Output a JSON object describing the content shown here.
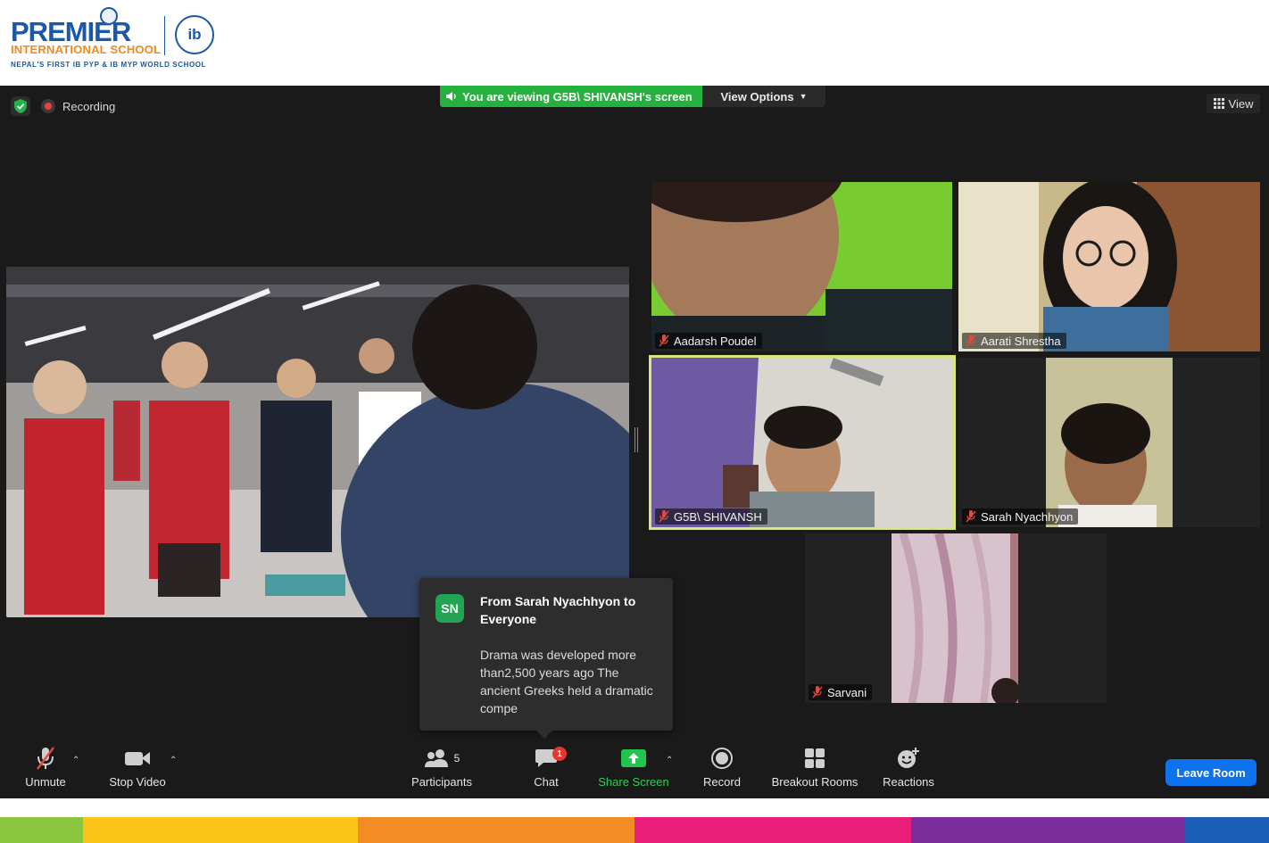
{
  "logo": {
    "name": "PREMIER",
    "subtitle": "INTERNATIONAL SCHOOL",
    "tagline": "NEPAL'S FIRST IB PYP & IB MYP WORLD SCHOOL",
    "ib_text": "ib"
  },
  "meeting": {
    "recording_label": "Recording",
    "viewing_banner": "You are viewing G5B\\ SHIVANSH's screen",
    "view_options_label": "View Options",
    "view_label": "View"
  },
  "participants": [
    {
      "name": "Aadarsh Poudel",
      "muted": true
    },
    {
      "name": "Aarati Shrestha",
      "muted": true
    },
    {
      "name": "G5B\\ SHIVANSH",
      "muted": true,
      "active_speaker": true
    },
    {
      "name": "Sarah Nyachhyon",
      "muted": true
    },
    {
      "name": "Sarvani",
      "muted": true
    }
  ],
  "chat_popup": {
    "initials": "SN",
    "title": "From Sarah Nyachhyon to Everyone",
    "message": "Drama was developed more than2,500 years ago The ancient Greeks held a dramatic compe"
  },
  "toolbar": {
    "unmute": "Unmute",
    "stop_video": "Stop Video",
    "participants": "Participants",
    "participant_count": "5",
    "chat": "Chat",
    "chat_badge": "1",
    "share_screen": "Share Screen",
    "record": "Record",
    "breakout_rooms": "Breakout Rooms",
    "reactions": "Reactions",
    "leave_room": "Leave Room"
  },
  "colors": {
    "brand_blue": "#1b58a8",
    "brand_orange": "#f08a1c",
    "share_green": "#24b13d",
    "leave_blue": "#0e72ed",
    "active_outline": "#d8e77a",
    "bottom_stripes": [
      "#8cc63f",
      "#fcc419",
      "#f38c24",
      "#e91e7a",
      "#7b2d9b",
      "#1c5fb8"
    ]
  },
  "icons": [
    "shield-icon",
    "recording-icon",
    "speaker-icon",
    "chevron-down-icon",
    "grid-view-icon",
    "microphone-muted-icon",
    "video-camera-icon",
    "participants-icon",
    "chat-icon",
    "share-screen-icon",
    "record-icon",
    "breakout-rooms-icon",
    "reactions-icon"
  ]
}
